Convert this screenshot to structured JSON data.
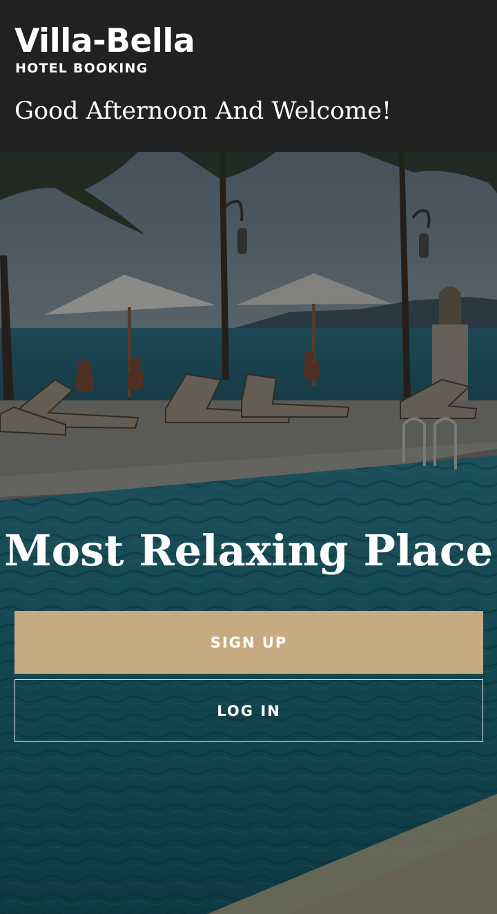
{
  "header": {
    "brand_name": "Villa-Bella",
    "brand_subtitle": "HOTEL BOOKING",
    "greeting": "Good Afternoon And Welcome!"
  },
  "hero": {
    "title": "Most Relaxing Place",
    "background_description_icon": "resort-pool-photo"
  },
  "actions": {
    "signup_label": "SIGN UP",
    "login_label": "LOG IN"
  },
  "colors": {
    "header_bg": "#212121",
    "signup_bg": "#c8aa82",
    "text": "#ffffff"
  }
}
